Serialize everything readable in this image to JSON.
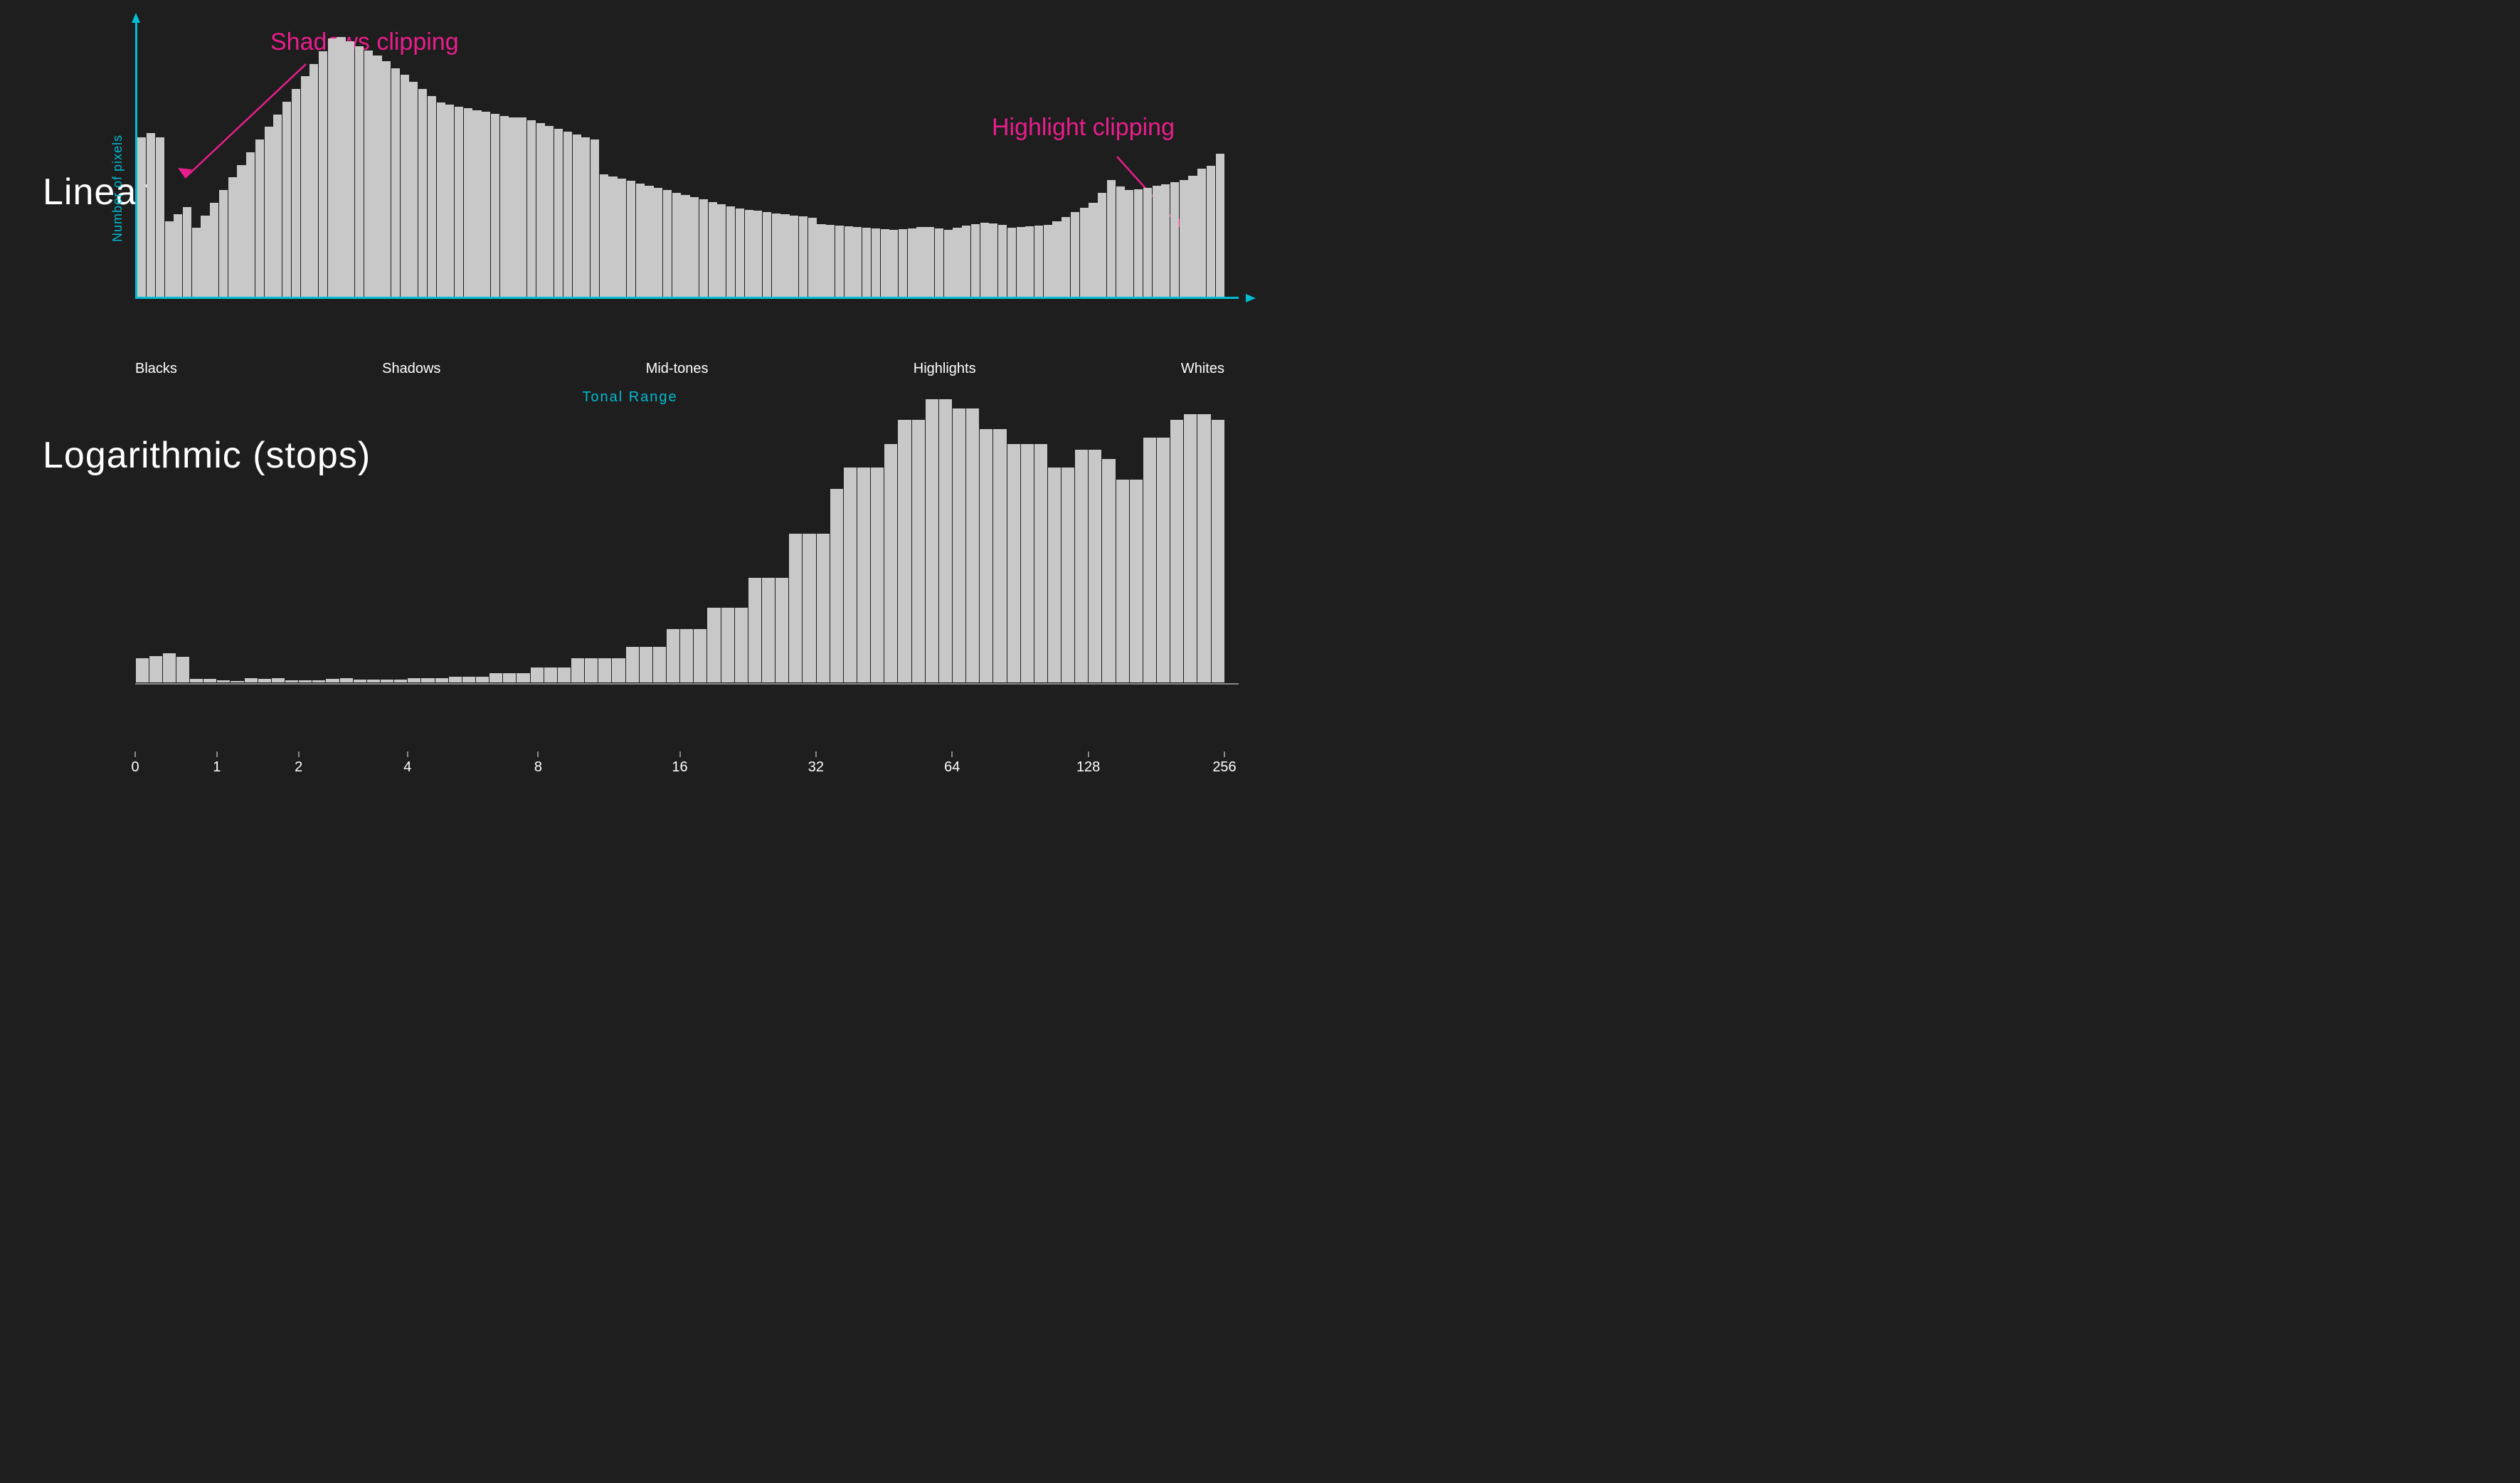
{
  "page": {
    "background": "#1e1e1e"
  },
  "top_chart": {
    "title": "Linear",
    "y_axis_label": "Number of pixels",
    "x_labels": [
      "Blacks",
      "Shadows",
      "Mid-tones",
      "Highlights",
      "Whites"
    ],
    "tonal_range": "Tonal Range",
    "annotation_shadows": "Shadows clipping",
    "annotation_highlights": "Highlight clipping"
  },
  "bottom_chart": {
    "title": "Logarithmic (stops)",
    "x_labels": [
      {
        "val": "0",
        "pct": 0
      },
      {
        "val": "1",
        "pct": 7.5
      },
      {
        "val": "2",
        "pct": 15
      },
      {
        "val": "4",
        "pct": 25
      },
      {
        "val": "8",
        "pct": 37
      },
      {
        "val": "16",
        "pct": 50
      },
      {
        "val": "32",
        "pct": 62.5
      },
      {
        "val": "64",
        "pct": 75
      },
      {
        "val": "128",
        "pct": 87.5
      },
      {
        "val": "256",
        "pct": 100
      }
    ]
  }
}
